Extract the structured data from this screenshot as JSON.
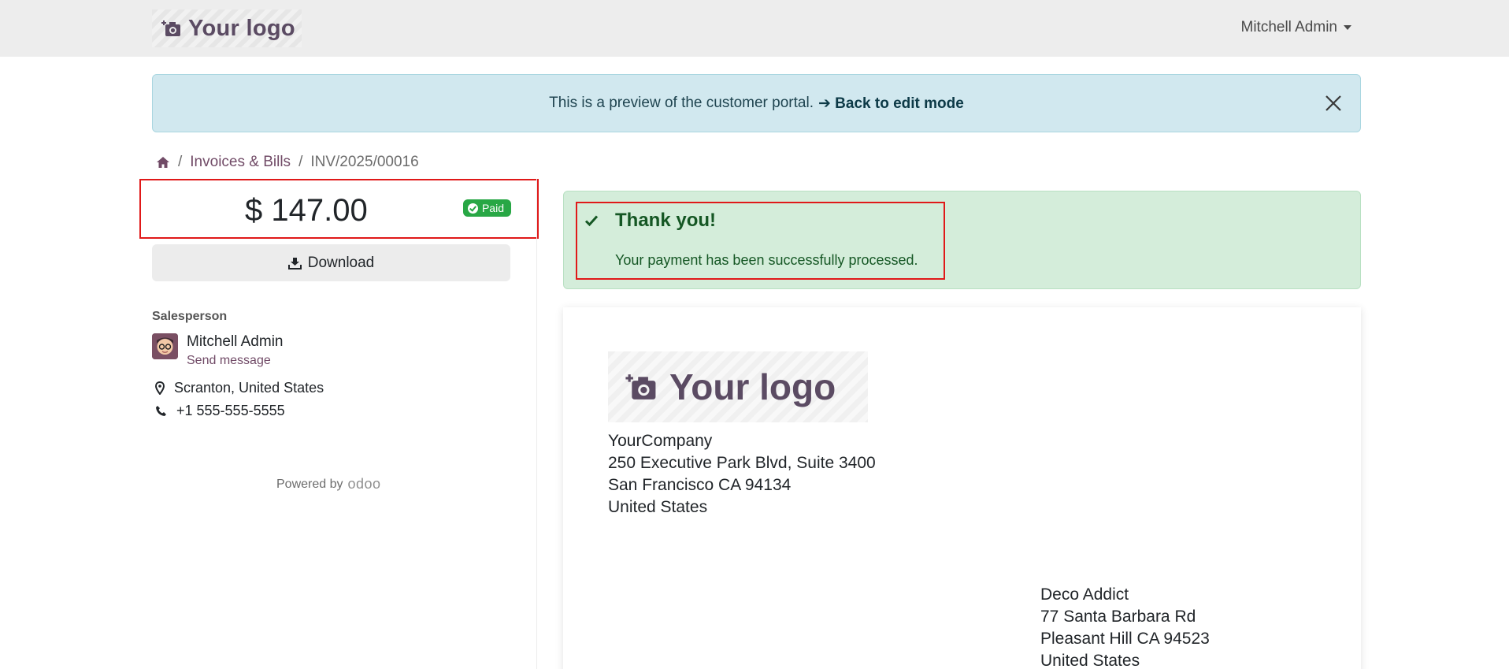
{
  "header": {
    "logo_text": "Your logo",
    "user_name": "Mitchell Admin"
  },
  "preview_banner": {
    "text": "This is a preview of the customer portal.",
    "link": "➔ Back to edit mode"
  },
  "breadcrumb": {
    "items": [
      "Invoices & Bills",
      "INV/2025/00016"
    ],
    "separator": "/"
  },
  "invoice": {
    "amount": "$ 147.00",
    "status": "Paid",
    "download_label": "Download"
  },
  "salesperson": {
    "label": "Salesperson",
    "name": "Mitchell Admin",
    "message_link": "Send message",
    "location": "Scranton, United States",
    "phone": "+1 555-555-5555"
  },
  "footer": {
    "powered_by": "Powered by",
    "brand": "odoo"
  },
  "payment_alert": {
    "title": "Thank you!",
    "message": "Your payment has been successfully processed."
  },
  "document": {
    "logo_text": "Your logo",
    "company": [
      "YourCompany",
      "250 Executive Park Blvd, Suite 3400",
      "San Francisco CA 94134",
      "United States"
    ],
    "customer": [
      "Deco Addict",
      "77 Santa Barbara Rd",
      "Pleasant Hill CA 94523",
      "United States"
    ]
  },
  "colors": {
    "brand": "#714b67",
    "success": "#28a745",
    "info_bg": "#d1e8ef",
    "success_bg": "#d4edda",
    "highlight": "#e01919"
  }
}
